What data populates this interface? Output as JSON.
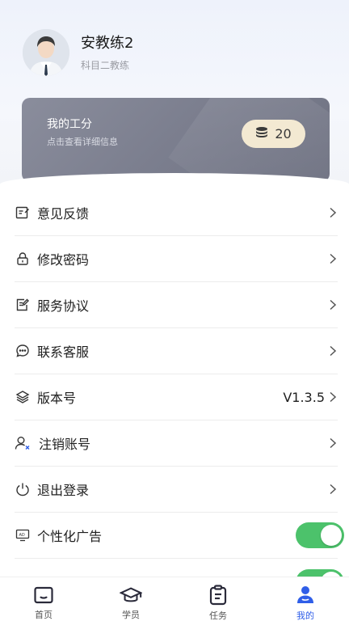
{
  "profile": {
    "name": "安教练2",
    "role": "科目二教练"
  },
  "points_card": {
    "title": "我的工分",
    "subtitle": "点击查看详细信息",
    "value": "20"
  },
  "menu": {
    "feedback": "意见反馈",
    "change_password": "修改密码",
    "service_agreement": "服务协议",
    "contact_service": "联系客服",
    "version_label": "版本号",
    "version_value": "V1.3.5",
    "delete_account": "注销账号",
    "logout": "退出登录",
    "personalized_ads": "个性化广告"
  },
  "tabs": {
    "home": "首页",
    "students": "学员",
    "tasks": "任务",
    "mine": "我的"
  },
  "colors": {
    "accent": "#2f5ee8",
    "toggle_on": "#4cc26b",
    "badge_bg": "#f3e9d2"
  }
}
